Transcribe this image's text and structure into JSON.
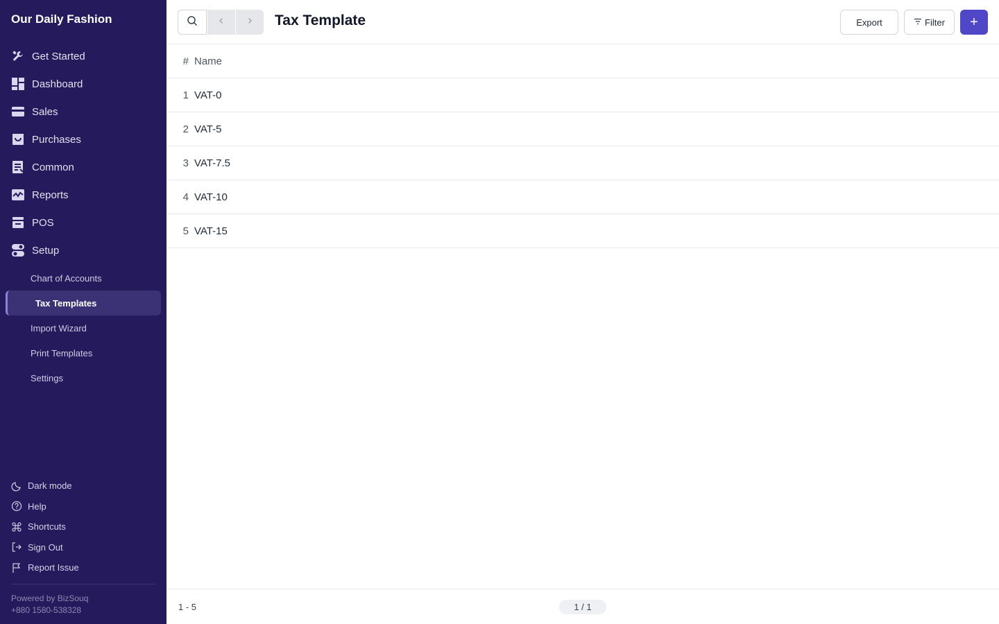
{
  "sidebar": {
    "brand": "Our Daily Fashion",
    "items": [
      {
        "label": "Get Started",
        "icon": "wrench-icon"
      },
      {
        "label": "Dashboard",
        "icon": "dashboard-icon"
      },
      {
        "label": "Sales",
        "icon": "sales-icon"
      },
      {
        "label": "Purchases",
        "icon": "purchases-icon"
      },
      {
        "label": "Common",
        "icon": "common-icon"
      },
      {
        "label": "Reports",
        "icon": "reports-icon"
      },
      {
        "label": "POS",
        "icon": "pos-icon"
      },
      {
        "label": "Setup",
        "icon": "setup-toggle-icon"
      }
    ],
    "setup_subitems": [
      {
        "label": "Chart of Accounts"
      },
      {
        "label": "Tax Templates",
        "active": true
      },
      {
        "label": "Import Wizard"
      },
      {
        "label": "Print Templates"
      },
      {
        "label": "Settings"
      }
    ],
    "bottom_items": [
      {
        "label": "Dark mode",
        "icon": "moon-icon"
      },
      {
        "label": "Help",
        "icon": "help-circle-icon"
      },
      {
        "label": "Shortcuts",
        "icon": "command-icon"
      },
      {
        "label": "Sign Out",
        "icon": "sign-out-icon"
      },
      {
        "label": "Report Issue",
        "icon": "flag-icon"
      }
    ],
    "powered_by": "Powered by BizSouq",
    "phone": "+880 1580-538328",
    "colors": {
      "background": "#241a5c",
      "active_item": "#3b3275"
    }
  },
  "header": {
    "title": "Tax Template",
    "export_label": "Export",
    "filter_label": "Filter",
    "add_label": "+",
    "accent": "#4f46c8"
  },
  "table": {
    "columns": [
      "#",
      "Name"
    ],
    "rows": [
      {
        "num": "1",
        "name": "VAT-0"
      },
      {
        "num": "2",
        "name": "VAT-5"
      },
      {
        "num": "3",
        "name": "VAT-7.5"
      },
      {
        "num": "4",
        "name": "VAT-10"
      },
      {
        "num": "5",
        "name": "VAT-15"
      }
    ]
  },
  "footer": {
    "count": "1 - 5",
    "page": "1 / 1"
  }
}
